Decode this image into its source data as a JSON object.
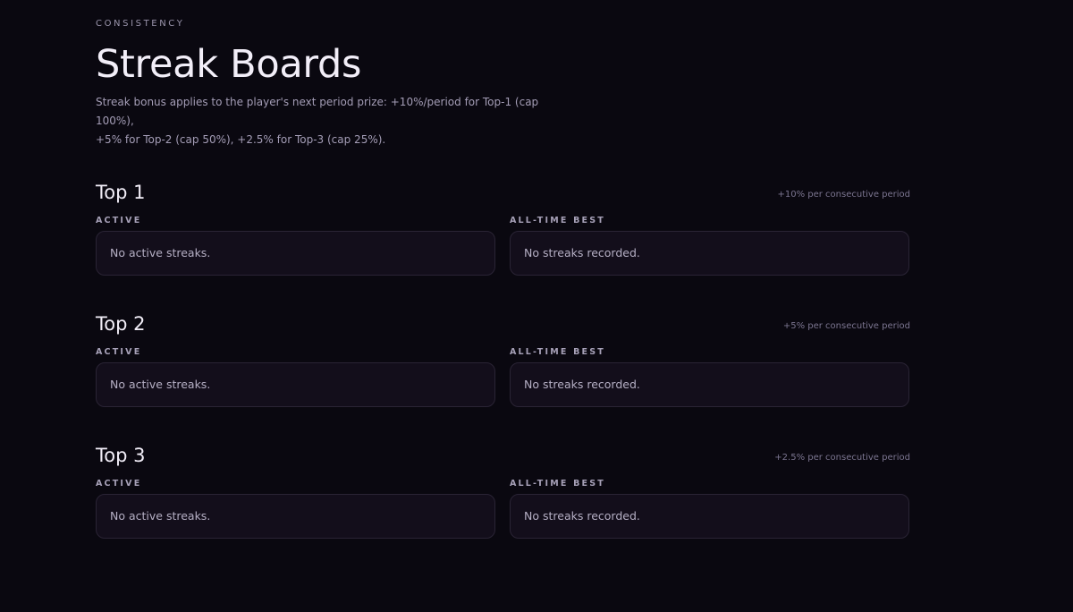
{
  "header": {
    "eyebrow": "CONSISTENCY",
    "title": "Streak Boards",
    "intro_line1": "Streak bonus applies to the player's next period prize: +10%/period for Top-1 (cap 100%),",
    "intro_line2": "+5% for Top-2 (cap 50%), +2.5% for Top-3 (cap 25%)."
  },
  "sections": [
    {
      "title": "Top 1",
      "note": "+10% per consecutive period",
      "active_label": "ACTIVE",
      "active_empty": "No active streaks.",
      "best_label": "ALL-TIME BEST",
      "best_empty": "No streaks recorded."
    },
    {
      "title": "Top 2",
      "note": "+5% per consecutive period",
      "active_label": "ACTIVE",
      "active_empty": "No active streaks.",
      "best_label": "ALL-TIME BEST",
      "best_empty": "No streaks recorded."
    },
    {
      "title": "Top 3",
      "note": "+2.5% per consecutive period",
      "active_label": "ACTIVE",
      "active_empty": "No active streaks.",
      "best_label": "ALL-TIME BEST",
      "best_empty": "No streaks recorded."
    }
  ],
  "colors": {
    "background": "#0a0810",
    "card": "#130e1b",
    "card_border": "#2a2435"
  }
}
